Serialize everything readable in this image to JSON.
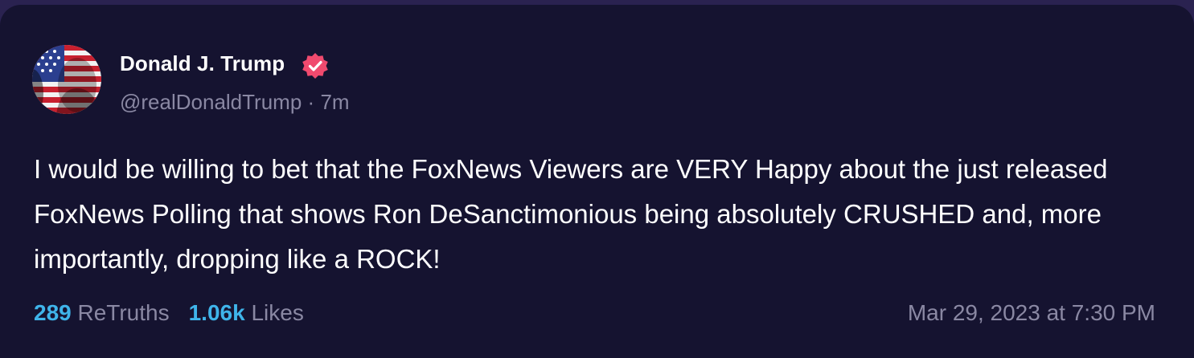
{
  "post": {
    "author": {
      "display_name": "Donald J. Trump",
      "handle": "@realDonaldTrump",
      "separator": "·",
      "age": "7m",
      "verified_icon": "verified-badge-icon",
      "avatar_icon": "avatar-flag-portrait"
    },
    "body": "I would be willing to bet that the FoxNews Viewers are VERY Happy about the just released FoxNews Polling that shows Ron DeSanctimonious being absolutely CRUSHED and, more importantly, dropping like a ROCK!",
    "stats": {
      "retruths_count": "289",
      "retruths_label": "ReTruths",
      "likes_count": "1.06k",
      "likes_label": "Likes"
    },
    "timestamp": "Mar 29, 2023 at 7:30 PM"
  },
  "colors": {
    "background": "#151330",
    "outer": "#2a2250",
    "accent": "#3fb4ea",
    "verified": "#f04a6e",
    "muted": "#8a88a3"
  }
}
